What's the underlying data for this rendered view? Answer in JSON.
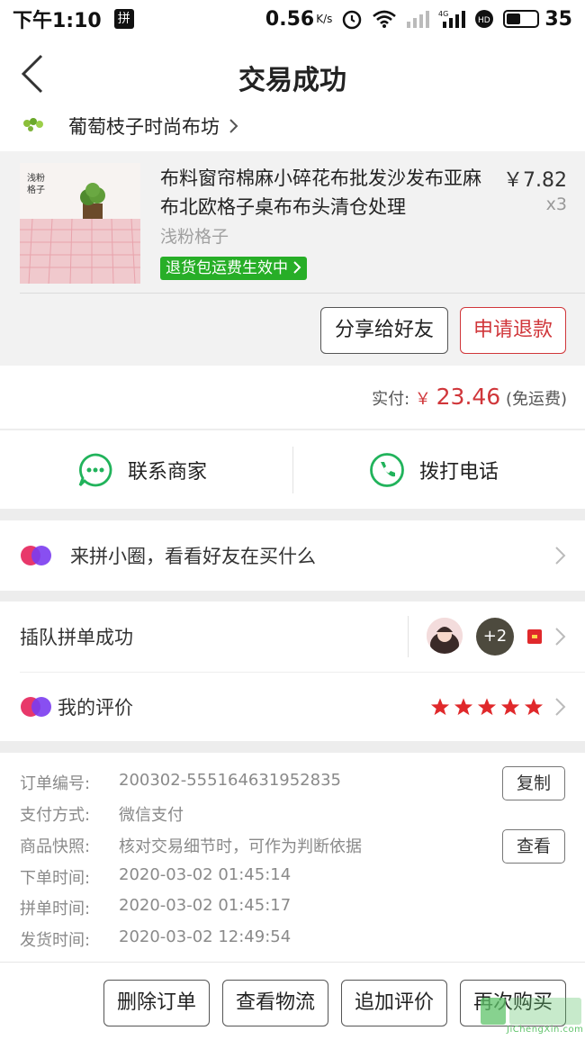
{
  "status_bar": {
    "time": "下午1:10",
    "app_badge": "拼",
    "speed": "0.56",
    "speed_unit": "K/s",
    "battery": "35"
  },
  "header": {
    "title": "交易成功"
  },
  "shop": {
    "name": "葡萄枝子时尚布坊"
  },
  "product": {
    "title": "布料窗帘棉麻小碎花布批发沙发布亚麻布北欧格子桌布布头清仓处理",
    "price": "￥7.82",
    "qty": "x3",
    "variant": "浅粉格子",
    "tag": "退货包运费生效中",
    "image_label": "浅粉\n格子",
    "share_label": "分享给好友",
    "refund_label": "申请退款"
  },
  "payment": {
    "paid_label": "实付:",
    "currency": "￥",
    "amount": "23.46",
    "shipping_note": "(免运费)"
  },
  "contact": {
    "merchant_label": "联系商家",
    "phone_label": "拨打电话"
  },
  "circle": {
    "label": "来拼小圈，看看好友在买什么"
  },
  "group": {
    "queue_label": "插队拼单成功",
    "extra_count": "+2"
  },
  "review": {
    "label": "我的评价",
    "stars": 5
  },
  "order_info": {
    "order_no_label": "订单编号:",
    "order_no": "200302-555164631952835",
    "copy_label": "复制",
    "pay_method_label": "支付方式:",
    "pay_method": "微信支付",
    "snapshot_label": "商品快照:",
    "snapshot": "核对交易细节时，可作为判断依据",
    "view_label": "查看",
    "order_time_label": "下单时间:",
    "order_time": "2020-03-02 01:45:14",
    "group_time_label": "拼单时间:",
    "group_time": "2020-03-02 01:45:17",
    "ship_time_label": "发货时间:",
    "ship_time": "2020-03-02 12:49:54"
  },
  "bottom_actions": {
    "delete_label": "删除订单",
    "logistics_label": "查看物流",
    "add_review_label": "追加评价",
    "rebuy_label": "再次购买"
  },
  "watermark": {
    "text": "JiChengXin.com"
  },
  "colors": {
    "accent_red": "#d0363a",
    "tag_green": "#27ae27",
    "contact_green": "#21b35b",
    "star_red": "#e0292b"
  }
}
